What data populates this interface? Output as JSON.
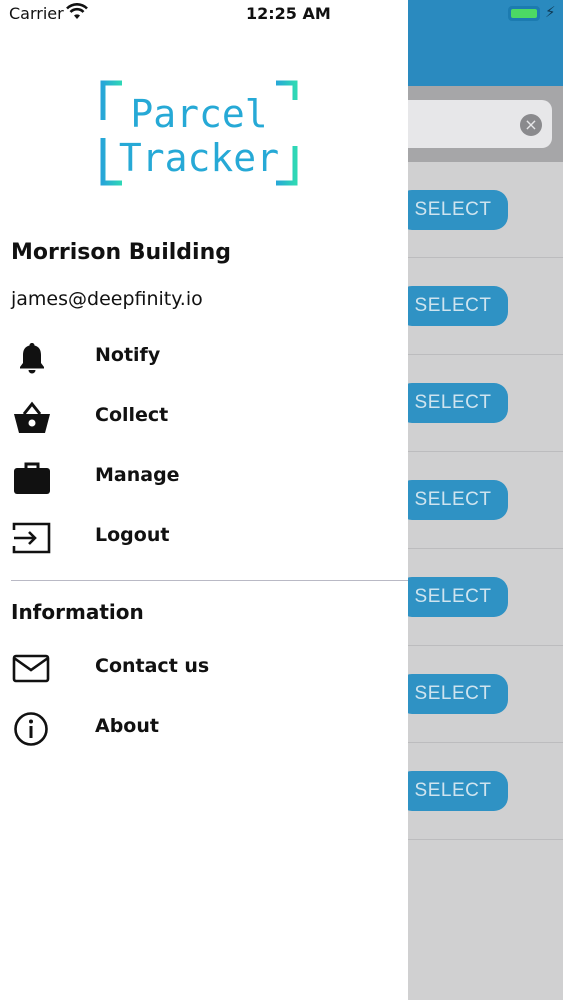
{
  "status_bar": {
    "carrier": "Carrier",
    "time": "12:25 AM"
  },
  "logo": {
    "line1": "Parcel",
    "line2": "Tracker"
  },
  "account": {
    "building": "Morrison Building",
    "email": "james@deepfinity.io"
  },
  "menu": [
    {
      "label": "Notify",
      "icon": "bell-icon"
    },
    {
      "label": "Collect",
      "icon": "basket-icon"
    },
    {
      "label": "Manage",
      "icon": "briefcase-icon"
    },
    {
      "label": "Logout",
      "icon": "logout-icon"
    }
  ],
  "information": {
    "title": "Information",
    "items": [
      {
        "label": "Contact us",
        "icon": "mail-icon"
      },
      {
        "label": "About",
        "icon": "info-icon"
      }
    ]
  },
  "background": {
    "select_label": "SELECT",
    "rows": 7
  },
  "colors": {
    "accent": "#2a8abf",
    "logo": "#26a9d6",
    "button": "#2f92c4"
  }
}
